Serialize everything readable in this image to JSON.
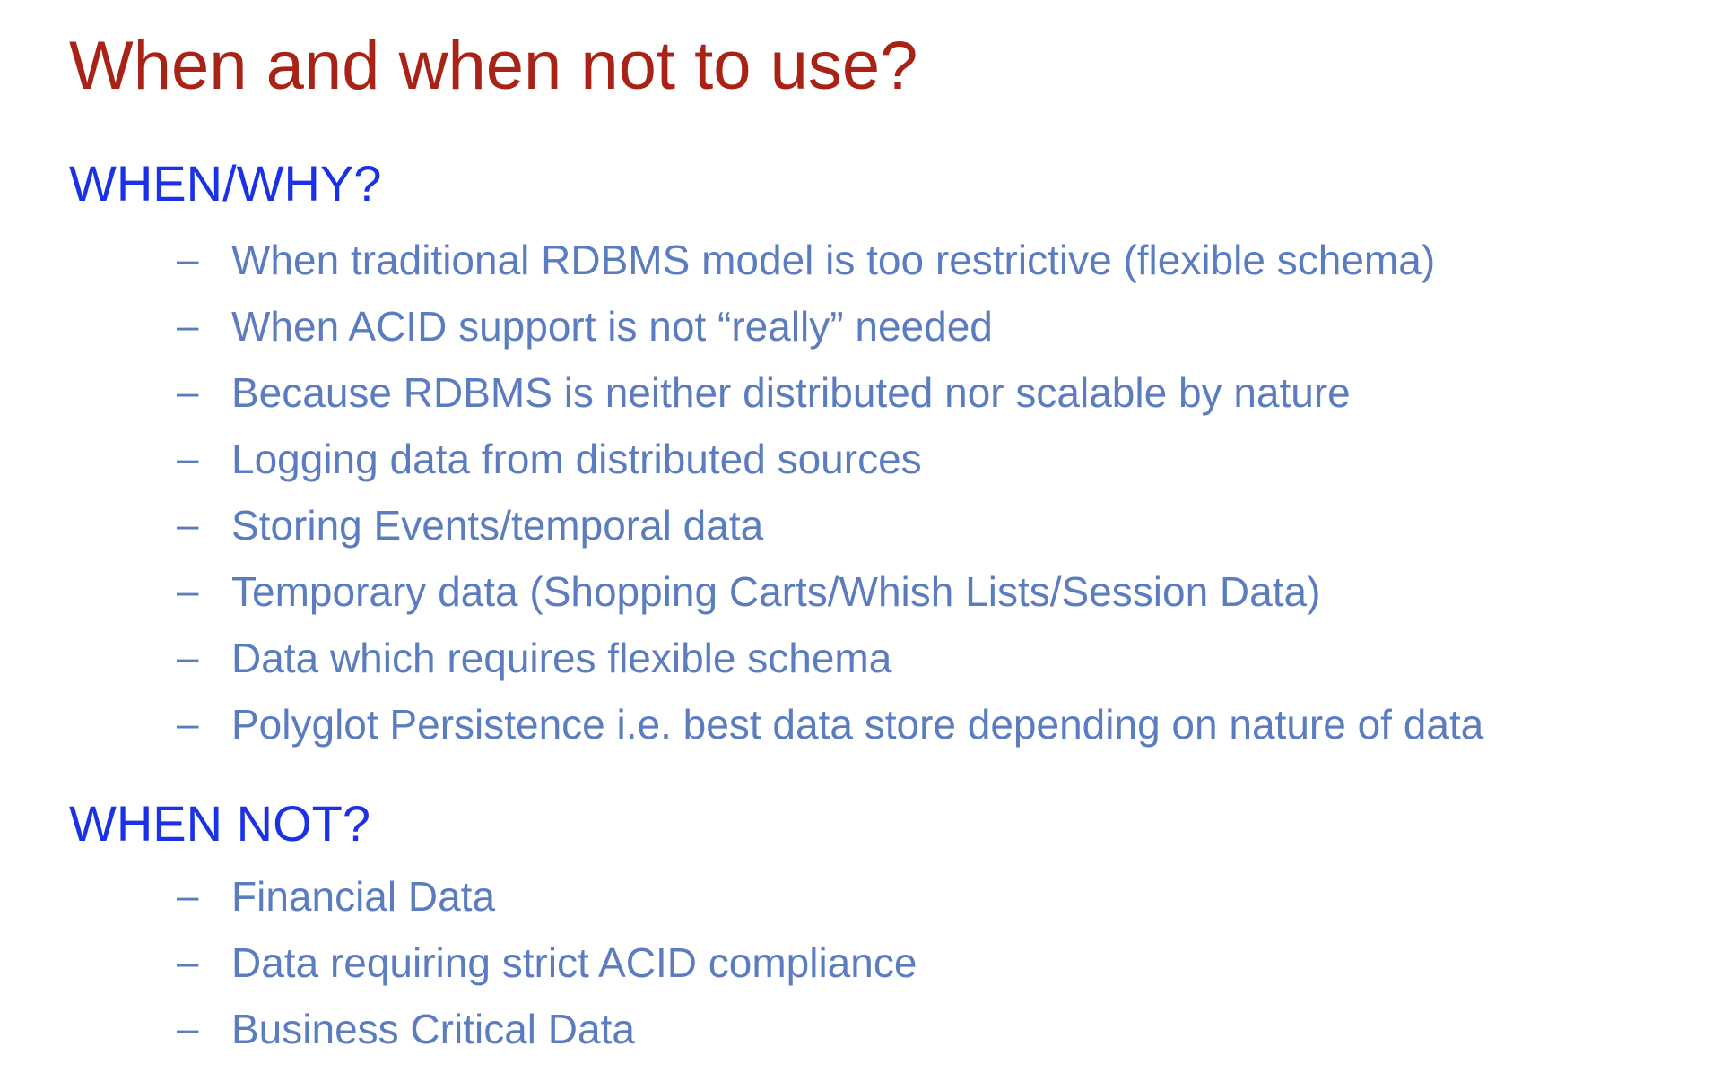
{
  "title": "When and when not to use?",
  "colors": {
    "title": "#A82215",
    "heading": "#1B31E6",
    "body": "#5B7DBF"
  },
  "sections": [
    {
      "heading": "WHEN/WHY?",
      "bullet": "–",
      "items": [
        "When traditional RDBMS model is too restrictive (flexible schema)",
        "When ACID support is not “really” needed",
        "Because RDBMS is neither distributed nor scalable by nature",
        "Logging data from distributed sources",
        "Storing Events/temporal data",
        "Temporary data (Shopping Carts/Whish Lists/Session Data)",
        "Data which requires flexible schema",
        "Polyglot Persistence i.e. best data store depending on nature of data"
      ]
    },
    {
      "heading": "WHEN NOT?",
      "bullet": "–",
      "items": [
        "Financial Data",
        "Data requiring strict ACID compliance",
        "Business Critical Data"
      ]
    }
  ]
}
